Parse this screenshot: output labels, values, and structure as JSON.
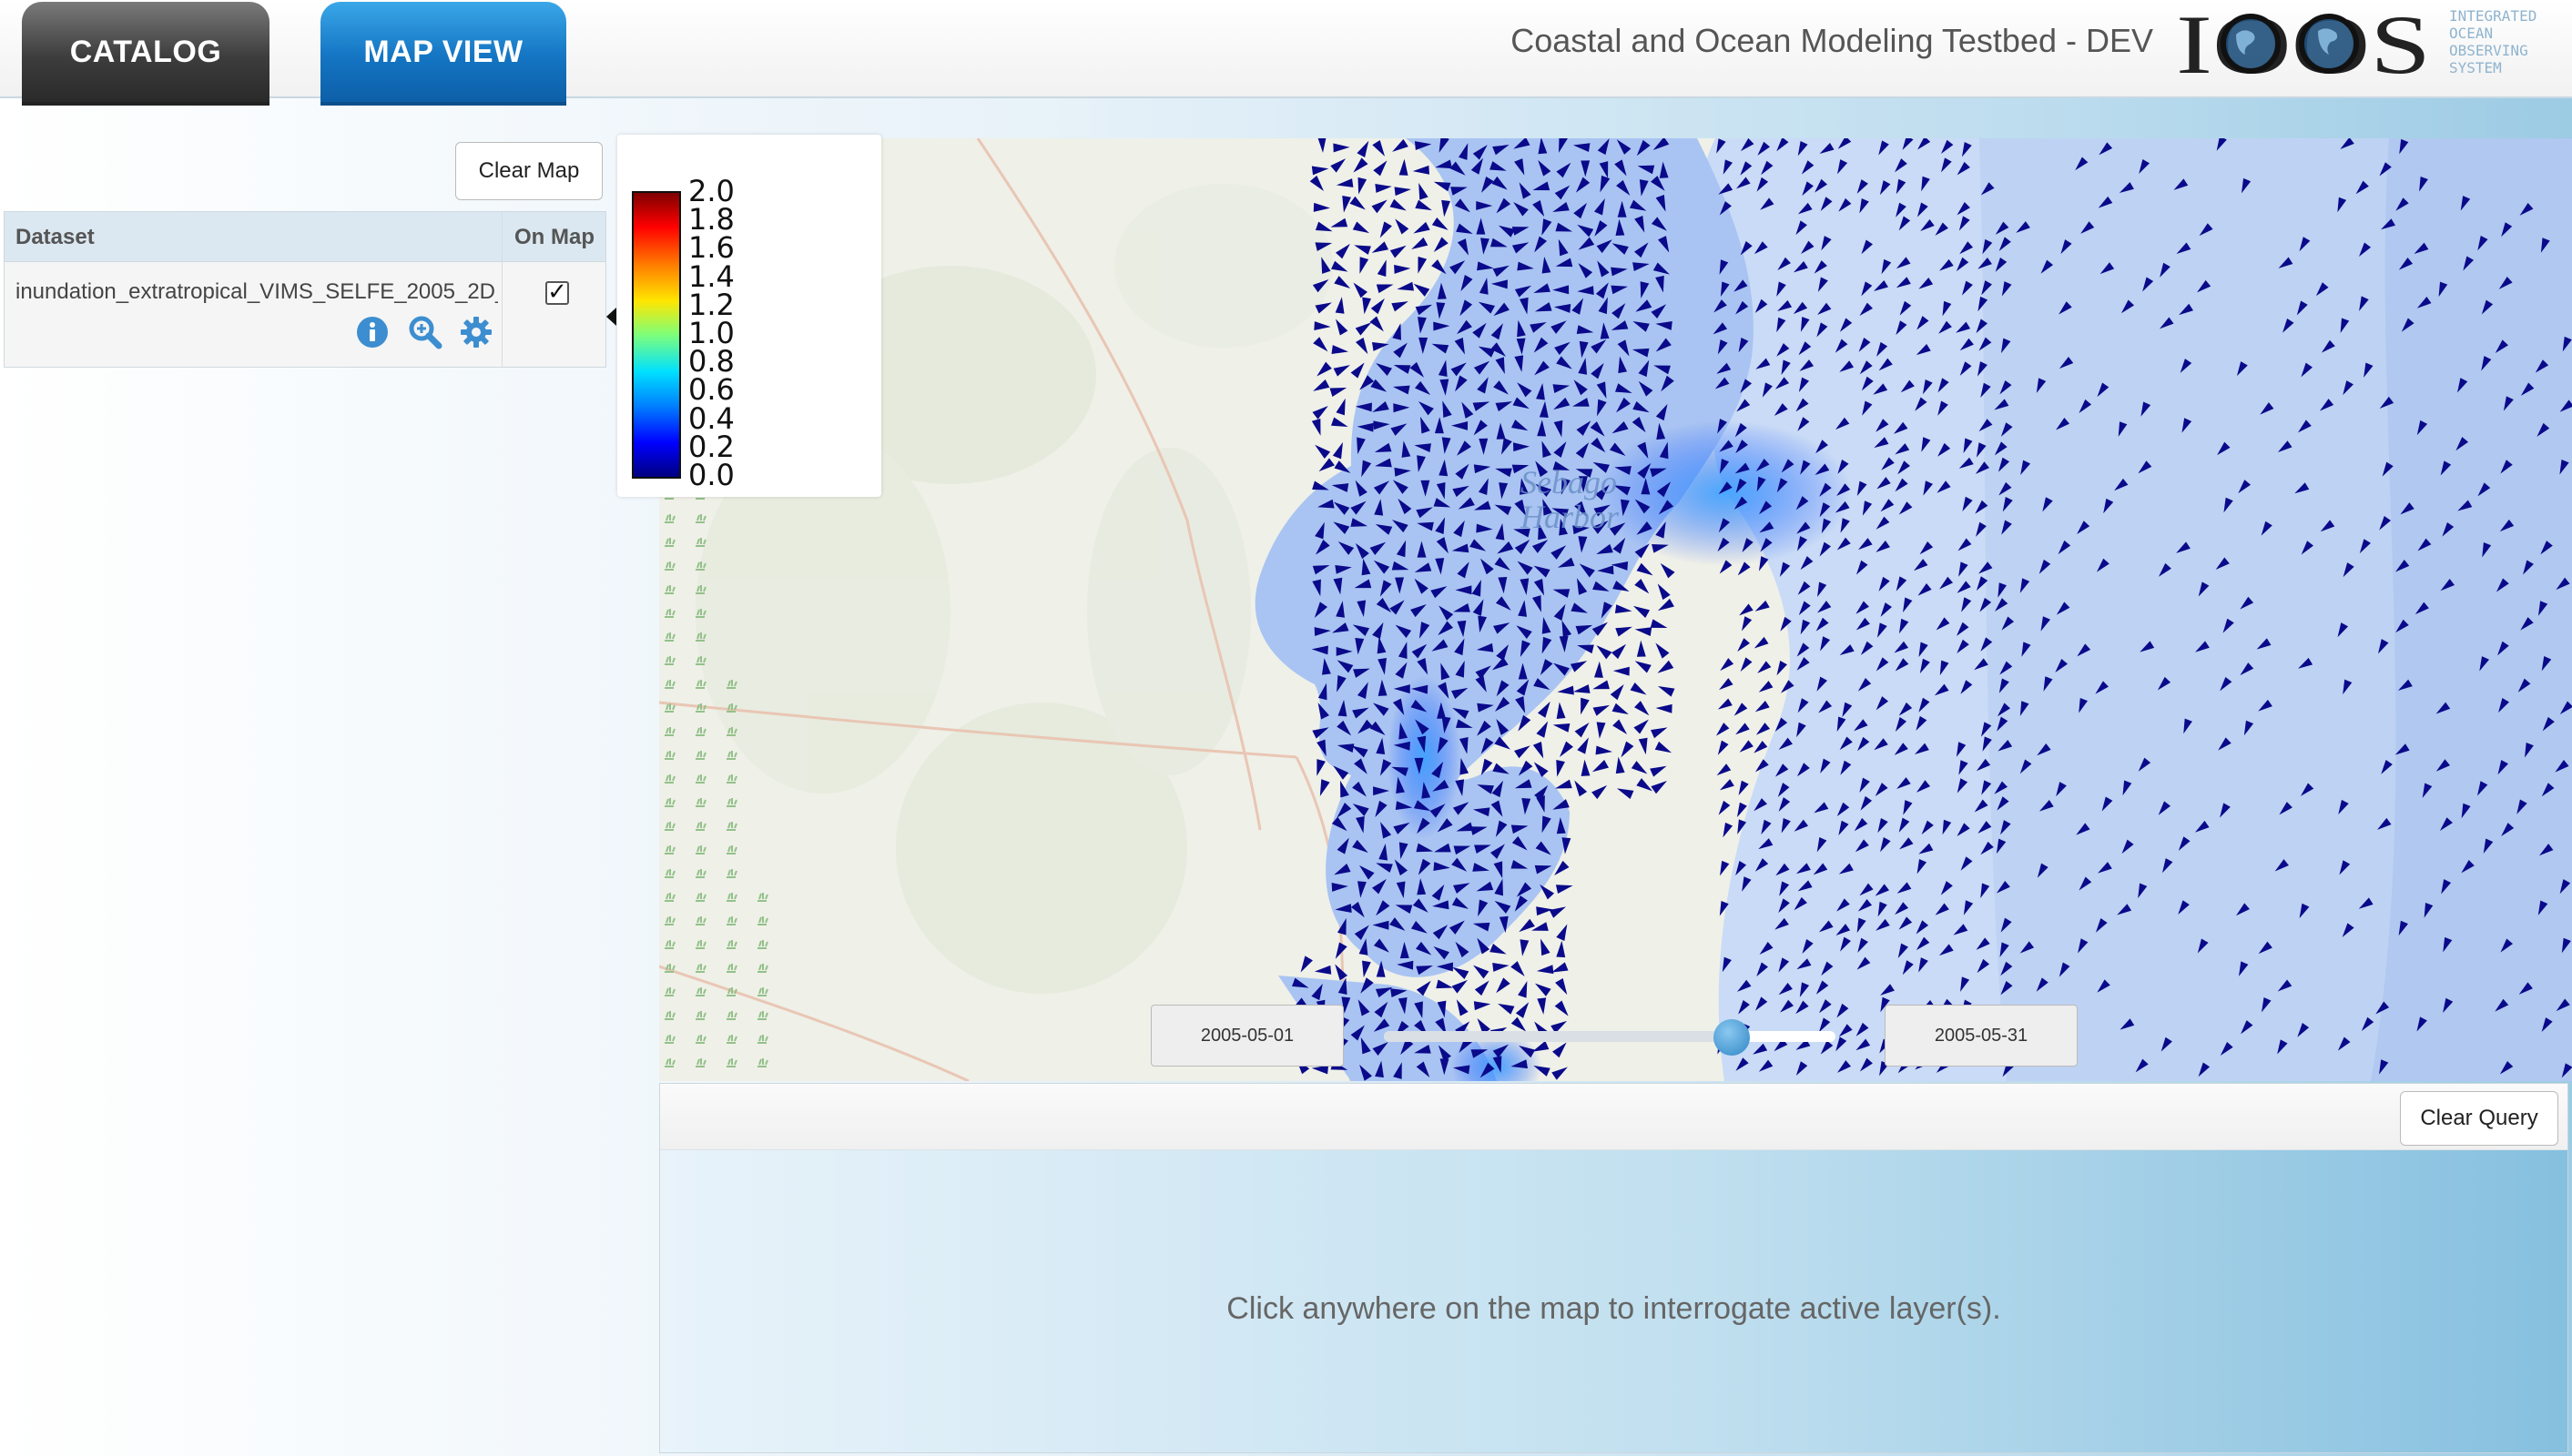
{
  "tabs": [
    {
      "label": "CATALOG",
      "active": false
    },
    {
      "label": "MAP VIEW",
      "active": true
    }
  ],
  "header": {
    "title": "Coastal and Ocean Modeling Testbed - DEV",
    "logo_text": "IOOS",
    "logo_tagline": [
      "INTEGRATED",
      "OCEAN",
      "OBSERVING",
      "SYSTEM"
    ]
  },
  "sidebar": {
    "clear_map_label": "Clear Map",
    "table": {
      "columns": [
        "Dataset",
        "On Map"
      ],
      "rows": [
        {
          "dataset": "inundation_extratropical_VIMS_SELFE_2005_2D_",
          "on_map": true,
          "actions": [
            "info-icon",
            "zoom-to-icon",
            "settings-icon"
          ]
        }
      ]
    }
  },
  "legend": {
    "ticks": [
      "2.0",
      "1.8",
      "1.6",
      "1.4",
      "1.2",
      "1.0",
      "0.8",
      "0.6",
      "0.4",
      "0.2",
      "0.0"
    ],
    "colormap": "jet"
  },
  "map": {
    "place_label": [
      "Sebago",
      "Harbor"
    ],
    "arrow_color": "#0a0a8a"
  },
  "time_slider": {
    "start": "2005-05-01",
    "end": "2005-05-31",
    "position_fraction": 0.77
  },
  "query": {
    "clear_label": "Clear Query",
    "message": "Click anywhere on the map to interrogate active layer(s)."
  },
  "colors": {
    "catalog_tab": "#3d3d3d",
    "map_tab": "#1475c3",
    "accent": "#2f86c5"
  }
}
